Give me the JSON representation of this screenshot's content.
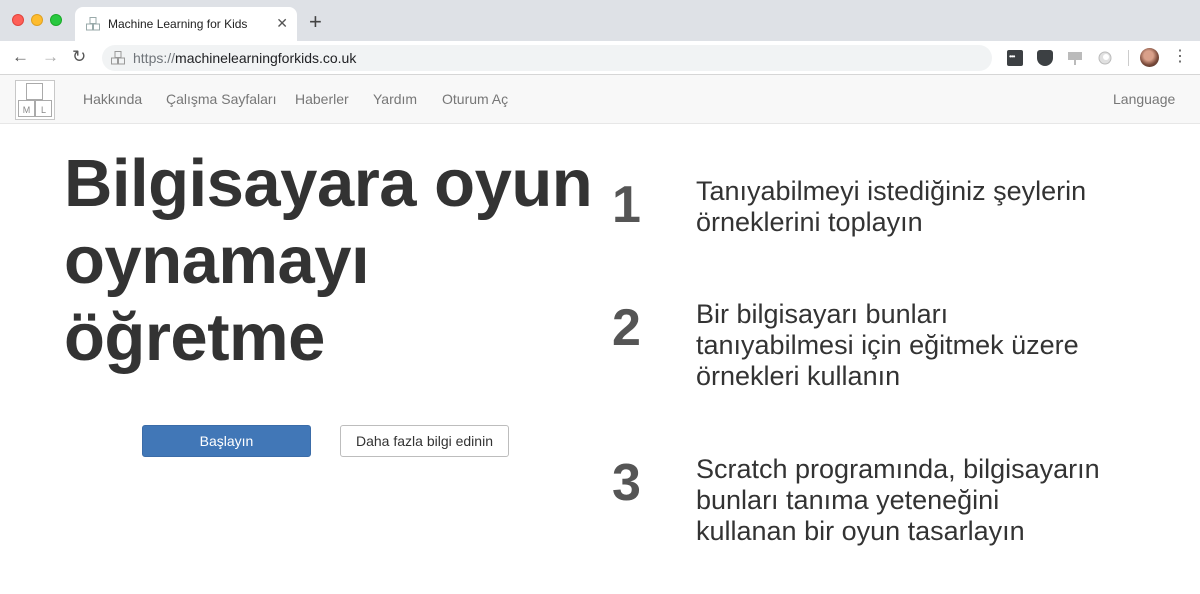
{
  "browser": {
    "tab_title": "Machine Learning for Kids",
    "tab_close": "✕",
    "new_tab": "+",
    "url_scheme": "https://",
    "url_host": "machinelearningforkids.co.uk",
    "back": "←",
    "forward": "→",
    "reload": "↻",
    "menu": "⋮"
  },
  "navbar": {
    "logo_letters": [
      "M",
      "L"
    ],
    "links": [
      "Hakkında",
      "Çalışma Sayfaları",
      "Haberler",
      "Yardım",
      "Oturum Aç"
    ],
    "language": "Language"
  },
  "hero": {
    "headline": [
      "Bilgisayara oyun",
      "oynamayı",
      "öğretme"
    ],
    "primary_button": "Başlayın",
    "secondary_button": "Daha fazla bilgi edinin"
  },
  "steps": [
    {
      "number": "1",
      "lines": [
        "Tanıyabilmeyi istediğiniz şeylerin",
        "örneklerini toplayın"
      ]
    },
    {
      "number": "2",
      "lines": [
        "Bir bilgisayarı bunları",
        "tanıyabilmesi için eğitmek üzere",
        "örnekleri kullanın"
      ]
    },
    {
      "number": "3",
      "lines": [
        "Scratch programında, bilgisayarın",
        "bunları tanıma yeteneğini",
        "kullanan bir oyun tasarlayın"
      ]
    }
  ],
  "icons": {
    "favicon": "ml-logo-icon",
    "extensions": [
      "keyboard-icon",
      "pocket-icon",
      "presentation-icon",
      "circle-icon"
    ],
    "profile": "avatar"
  },
  "colors": {
    "primary_button": "#4177b7",
    "navbar_bg": "#f8f8f8",
    "heading": "#333333",
    "step_number": "#555555"
  }
}
